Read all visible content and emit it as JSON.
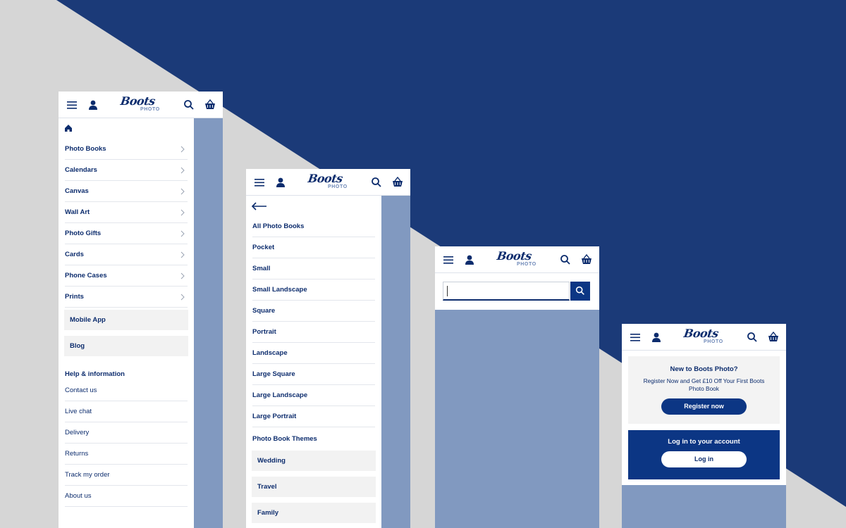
{
  "brand": {
    "logo_script": "Boots",
    "logo_sub": "PHOTO"
  },
  "colors": {
    "navy": "#0c3684",
    "background_blue": "#1b3a78",
    "panel_blue": "#8199c0",
    "grey": "#f2f2f2"
  },
  "icons": {
    "menu": "hamburger-icon",
    "account": "user-icon",
    "search": "search-icon",
    "basket": "basket-icon",
    "home": "home-icon",
    "back": "arrow-left-icon",
    "chevron": "chevron-right-icon"
  },
  "menu_screen": {
    "categories": [
      {
        "label": "Photo Books"
      },
      {
        "label": "Calendars"
      },
      {
        "label": "Canvas"
      },
      {
        "label": "Wall Art"
      },
      {
        "label": "Photo Gifts"
      },
      {
        "label": "Cards"
      },
      {
        "label": "Phone Cases"
      },
      {
        "label": "Prints"
      }
    ],
    "extras": [
      {
        "label": "Mobile App"
      },
      {
        "label": "Blog"
      }
    ],
    "help_title": "Help & information",
    "help_links": [
      {
        "label": "Contact us"
      },
      {
        "label": "Live chat"
      },
      {
        "label": "Delivery"
      },
      {
        "label": "Returns"
      },
      {
        "label": "Track my order"
      },
      {
        "label": "About us"
      }
    ]
  },
  "submenu_screen": {
    "items": [
      {
        "label": "All Photo Books"
      },
      {
        "label": "Pocket"
      },
      {
        "label": "Small"
      },
      {
        "label": "Small Landscape"
      },
      {
        "label": "Square"
      },
      {
        "label": "Portrait"
      },
      {
        "label": "Landscape"
      },
      {
        "label": "Large Square"
      },
      {
        "label": "Large Landscape"
      },
      {
        "label": "Large Portrait"
      }
    ],
    "themes_title": "Photo Book Themes",
    "themes": [
      {
        "label": "Wedding"
      },
      {
        "label": "Travel"
      },
      {
        "label": "Family"
      }
    ]
  },
  "search_screen": {
    "query": ""
  },
  "account_screen": {
    "register_title": "New to Boots Photo?",
    "register_desc": "Register Now and Get £10 Off Your First Boots Photo Book",
    "register_button": "Register now",
    "login_title": "Log in to your account",
    "login_button": "Log in"
  }
}
